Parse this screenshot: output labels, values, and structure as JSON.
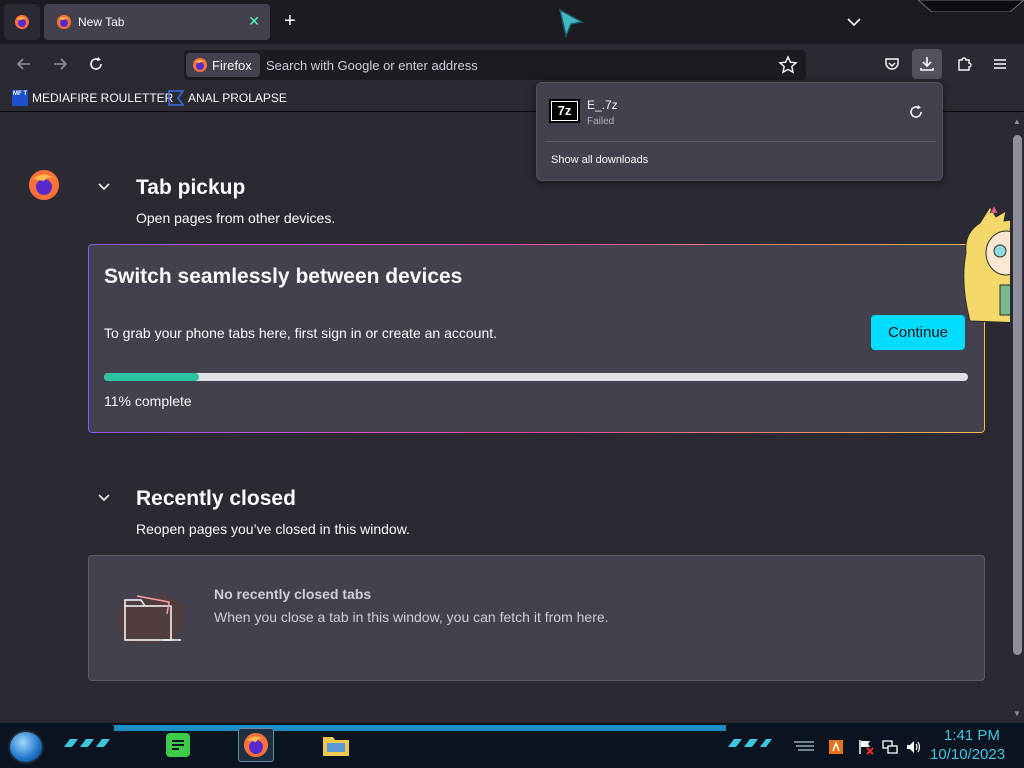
{
  "tabs": {
    "active_title": "New Tab"
  },
  "toolbar": {
    "identity_label": "Firefox",
    "url_placeholder": "Search with Google or enter address"
  },
  "bookmarks": [
    {
      "label": "MEDIAFIRE ROULETTER",
      "icon_text": "MF T"
    },
    {
      "label": "ANAL PROLAPSE"
    }
  ],
  "tab_pickup": {
    "title": "Tab pickup",
    "subtitle": "Open pages from other devices.",
    "card_title": "Switch seamlessly between devices",
    "card_text": "To grab your phone tabs here, first sign in or create an account.",
    "button_label": "Continue",
    "progress": 0.11,
    "progress_text": "11% complete"
  },
  "recently_closed": {
    "title": "Recently closed",
    "subtitle": "Reopen pages you’ve closed in this window.",
    "empty_title": "No recently closed tabs",
    "empty_text": "When you close a tab in this window, you can fetch it from here."
  },
  "downloads": {
    "items": [
      {
        "name": "E_.7z",
        "status": "Failed",
        "icon_text": "7z"
      }
    ],
    "show_all_label": "Show all downloads"
  },
  "taskbar": {
    "time": "1:41 PM",
    "date": "10/10/2023"
  },
  "colors": {
    "accent": "#00ddff",
    "progress": "#2ac3a2",
    "clock": "#3ec6e0"
  }
}
